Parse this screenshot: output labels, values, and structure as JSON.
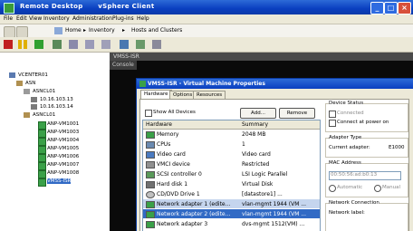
{
  "window": {
    "title": "Remote Desktop",
    "subtitle": "vSphere Client"
  },
  "menu": [
    "File",
    "Edit",
    "View",
    "Inventory",
    "Administration",
    "Plug-ins",
    "Help"
  ],
  "address": {
    "home": "Home",
    "crumb1": "Inventory",
    "crumb2": "Hosts and Clusters"
  },
  "inventory": {
    "root": "VCENTER01",
    "datacenter": "ASN",
    "cluster": "ASNCL01",
    "host": "10.16.103.13",
    "host2": "10.16.103.14",
    "vms": [
      "ANP-VM1001",
      "ANP-VM1003",
      "ANP-VM1004",
      "ANP-VM1005",
      "ANP-VM1006",
      "ANP-VM1007",
      "ANP-VM1008"
    ],
    "selected_vm": "VMSS-ISR"
  },
  "console": {
    "header": "VMSS-ISR",
    "tab": "Console"
  },
  "dialog": {
    "title": "VMSS-ISR - Virtual Machine Properties",
    "tabs": [
      "Hardware",
      "Options",
      "Resources"
    ],
    "show_all_devices": "Show All Devices",
    "add_button": "Add...",
    "remove_button": "Remove",
    "col_hardware": "Hardware",
    "col_summary": "Summary",
    "rows": [
      {
        "device": "Memory",
        "summary": "2048 MB"
      },
      {
        "device": "CPUs",
        "summary": "1"
      },
      {
        "device": "Video card",
        "summary": "Video card"
      },
      {
        "device": "VMCI device",
        "summary": "Restricted"
      },
      {
        "device": "SCSI controller 0",
        "summary": "LSI Logic Parallel"
      },
      {
        "device": "Hard disk 1",
        "summary": "Virtual Disk"
      },
      {
        "device": "CD/DVD Drive 1",
        "summary": "[datastore1] ..."
      },
      {
        "device": "Network adapter 1 (edite...",
        "summary": "vlan-mgmt 1944 (VM ..."
      },
      {
        "device": "Network adapter 2 (edite...",
        "summary": "vlan-mgmt 1944 (VM ..."
      },
      {
        "device": "Network adapter 3",
        "summary": "dvs-mgmt 1512(VM) ..."
      }
    ],
    "device_status": "Device Status",
    "connected": "Connected",
    "connect_at_power_on": "Connect at power on",
    "adapter_type": "Adapter Type",
    "current_adapter": "Current adapter:",
    "current_adapter_value": "E1000",
    "mac_address": "MAC Address",
    "mac_value": "00:50:56:ad:b0:13",
    "automatic": "Automatic",
    "manual": "Manual",
    "network_connection": "Network Connection",
    "network_label": "Network label:"
  }
}
